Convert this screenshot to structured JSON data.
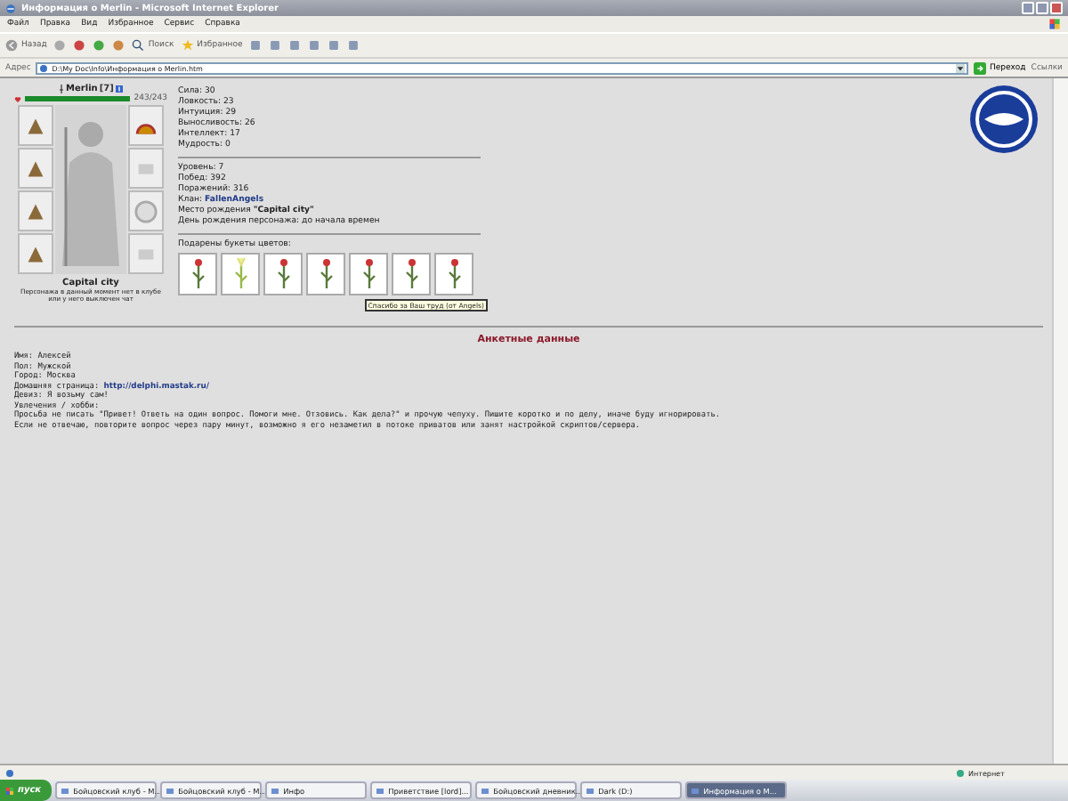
{
  "window": {
    "title": "Информация о Merlin - Microsoft Internet Explorer"
  },
  "menu": [
    "Файл",
    "Правка",
    "Вид",
    "Избранное",
    "Сервис",
    "Справка"
  ],
  "toolbar": {
    "back": "Назад",
    "search": "Поиск",
    "favorites": "Избранное"
  },
  "address": {
    "label": "Адрес",
    "value": "D:\\My Doc\\Info\\Информация о Merlin.htm",
    "go": "Переход",
    "links": "Ссылки"
  },
  "character": {
    "name": "Merlin",
    "rank": "[7]",
    "hp": {
      "reading": "243/243",
      "level": 1
    },
    "city": "Capital city",
    "note": "Персонажа в данный момент нет в клубе или у него выключен чат"
  },
  "stats": [
    {
      "label": "Сила:",
      "value": "30"
    },
    {
      "label": "Ловкость:",
      "value": "23"
    },
    {
      "label": "Интуиция:",
      "value": "29"
    },
    {
      "label": "Выносливость:",
      "value": "26"
    },
    {
      "label": "Интеллект:",
      "value": "17"
    },
    {
      "label": "Мудрость:",
      "value": "0"
    }
  ],
  "record": [
    {
      "label": "Уровень:",
      "value": "7",
      "kind": "plain"
    },
    {
      "label": "Побед:",
      "value": "392",
      "kind": "plain"
    },
    {
      "label": "Поражений:",
      "value": "316",
      "kind": "plain"
    },
    {
      "label": "Клан:",
      "value": "FallenAngels",
      "kind": "link"
    },
    {
      "label": "Место рождения",
      "value": "\"Capital city\"",
      "kind": "bold"
    },
    {
      "label": "День рождения персонажа:",
      "value": "до начала времен",
      "kind": "plain"
    }
  ],
  "flowers": {
    "label": "Подарены букеты цветов:",
    "items": [
      {
        "kind": "rose"
      },
      {
        "kind": "lily"
      },
      {
        "kind": "rose"
      },
      {
        "kind": "rose"
      },
      {
        "kind": "rose"
      },
      {
        "kind": "rose"
      },
      {
        "kind": "rose"
      }
    ],
    "tooltip": "Спасибо за Ваш труд (от Angels)"
  },
  "profile": {
    "heading": "Анкетные данные",
    "fields": [
      {
        "label": "Имя:",
        "value": "Алексей",
        "kind": "plain"
      },
      {
        "label": "Пол:",
        "value": "Мужской",
        "kind": "plain"
      },
      {
        "label": "Город:",
        "value": "Москва",
        "kind": "plain"
      },
      {
        "label": "Домашняя страница:",
        "value": "http://delphi.mastak.ru/",
        "kind": "link"
      },
      {
        "label": "Девиз:",
        "value": "Я возьму сам!",
        "kind": "plain"
      },
      {
        "label": "Увлечения / хобби:"
      }
    ],
    "notes": [
      "Просьба не писать \"Привет! Ответь на один вопрос. Помоги мне. Отзовись. Как дела?\" и прочую чепуху. Пишите коротко и по делу, иначе буду игнорировать.",
      "Если не отвечаю, повторите вопрос через пару минут, возможно я его незаметил в потоке приватов или занят настройкой скриптов/сервера."
    ]
  },
  "status_bar": {
    "zone": "Интернет"
  },
  "taskbar": {
    "start": "пуск",
    "tasks": [
      {
        "label": "Бойцовский клуб - M...",
        "selected": false
      },
      {
        "label": "Бойцовский клуб - M...",
        "selected": false
      },
      {
        "label": "Инфо",
        "selected": false
      },
      {
        "label": "Приветствие [lord]...",
        "selected": false
      },
      {
        "label": "Бойцовский дневник...",
        "selected": false
      },
      {
        "label": "Dark (D:)",
        "selected": false
      },
      {
        "label": "Информация о M...",
        "selected": true
      }
    ]
  }
}
